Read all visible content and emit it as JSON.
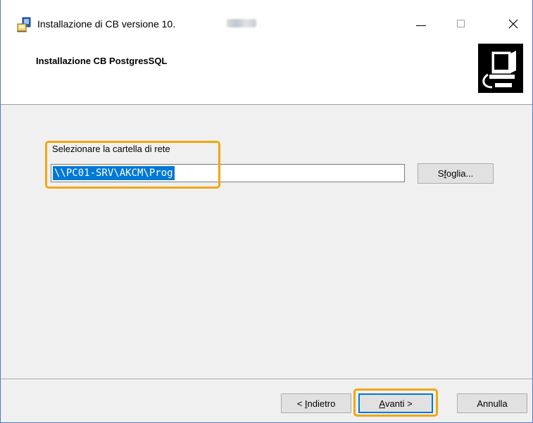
{
  "window": {
    "title": "Installazione di CB versione 10."
  },
  "header": {
    "title": "Installazione CB PostgresSQL"
  },
  "form": {
    "label": "Selezionare la cartella di rete",
    "path_value": "\\\\PC01-SRV\\AKCM\\Prog",
    "browse_prefix": "S",
    "browse_underline": "f",
    "browse_suffix": "oglia..."
  },
  "footer": {
    "back_prefix": "< ",
    "back_underline": "I",
    "back_suffix": "ndietro",
    "next_underline": "A",
    "next_suffix": "vanti >",
    "cancel_label": "Annulla"
  },
  "colors": {
    "highlight": "#f0a70f",
    "selection": "#0078d7"
  }
}
